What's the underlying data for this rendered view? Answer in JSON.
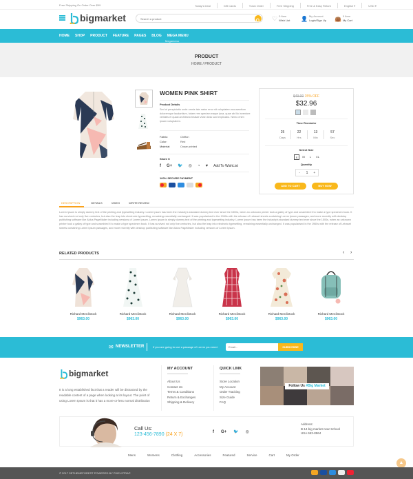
{
  "topbar": {
    "promo": "Free Shipping On Order Over $99",
    "links": [
      "Today's Deal",
      "Gift Cards",
      "Track Order",
      "Free Shipping",
      "Free & Easy Return"
    ],
    "language": "English",
    "currency": "USD"
  },
  "header": {
    "logo": "bigmarket",
    "search_placeholder": "Search a product",
    "wishlist": {
      "line1": "0 Item",
      "line2": "Wish List"
    },
    "account": {
      "line1": "My Account",
      "line2": "Login/Sign Up"
    },
    "cart": {
      "line1": "0 Item",
      "line2": "My Cart"
    }
  },
  "nav": {
    "items": [
      "HOME",
      "SHOP",
      "PRODUCT",
      "FEATURE",
      "PAGES",
      "BLOG"
    ],
    "menu_label": "MEGA MENU",
    "menu_sub": "Megamenu"
  },
  "banner": {
    "title": "PRODUCT",
    "breadcrumb_home": "HOME",
    "breadcrumb_sep": "/",
    "breadcrumb_current": "PRODUCT"
  },
  "product": {
    "title": "WOMEN PINK SHIRT",
    "details_heading": "Product Details",
    "details_text": "Sed ut perspiciatis unde omnis iste natus error sit voluptatem accusantium doloremque laudantium, totam rem aperiam eaque ipsa, quae ab illo inventore veritatis et quasi architecto beatae vitae dicta sunt explicabo. Nemo enim ipsam voluptatem.",
    "specs": [
      {
        "label": "Fabric:",
        "value": "Chiffon"
      },
      {
        "label": "Color:",
        "value": "Red"
      },
      {
        "label": "Material:",
        "value": "Crepe printed"
      }
    ],
    "share_label": "Share It",
    "wishlist_label": "Add To WishList",
    "secure_label": "100% SECURE PAYMENT"
  },
  "buybox": {
    "old_price": "$49.00",
    "discount": "15% OFF",
    "price": "$32.96",
    "time_heading": "Time Reminder",
    "countdown": [
      {
        "value": "25",
        "unit": "Days"
      },
      {
        "value": "22",
        "unit": "Hrs"
      },
      {
        "value": "13",
        "unit": "Min"
      },
      {
        "value": "57",
        "unit": "Sec"
      }
    ],
    "size_heading": "Select Size",
    "sizes": [
      "S",
      "M",
      "L",
      "XL"
    ],
    "selected_size": "S",
    "qty_heading": "Quantity",
    "qty_minus": "-",
    "qty_value": "1",
    "qty_plus": "+",
    "add_to_cart": "ADD TO CART",
    "buy_now": "BUY NOW"
  },
  "tabs": {
    "items": [
      "DESCRIPTION",
      "DETAILS",
      "VIDEO",
      "WRITE REVIEW"
    ],
    "active": "DESCRIPTION",
    "content": "Lorem Ipsum is simply dummy text of the printing and typesetting industry. Lorem Ipsum has been the industry's standard dummy text ever since the 1500s, when an unknown printer took a galley of type and scrambled it to make a type specimen book. It has survived not only five centuries, but also the leap into electronic typesetting, remaining essentially unchanged. It was popularised in the 1960s with the release of Letraset sheets containing Lorem Ipsum passages, and more recently with desktop publishing software like Aldus PageMaker including versions of Lorem Ipsum. Lorem Ipsum is simply dummy text of the printing and typesetting industry. Lorem Ipsum has been the industry's standard dummy text ever since the 1500s, when an unknown printer took a galley of type and scrambled it to make a type specimen book. It has survived not only five centuries, but also the leap into electronic typesetting, remaining essentially unchanged. It was popularised in the 1960s with the release of Letraset sheets containing Lorem Ipsum passages, and more recently with desktop publishing software like Aldus PageMaker including versions of Lorem Ipsum."
  },
  "related": {
    "heading": "RELATED PRODUCTS",
    "items": [
      {
        "name": "Richard McClintock",
        "price": "$963.00"
      },
      {
        "name": "Richard McClintock",
        "price": "$963.00"
      },
      {
        "name": "Richard McClintock",
        "price": "$963.00"
      },
      {
        "name": "Richard McClintock",
        "price": "$963.00"
      },
      {
        "name": "Richard McClintock",
        "price": "$963.00"
      },
      {
        "name": "Richard McClintock",
        "price": "$963.00"
      }
    ]
  },
  "newsletter": {
    "heading": "NEWSLETTER",
    "text": "If you are going to use a passage of Lorem you need.",
    "placeholder": "Email...",
    "button": "SUBSCRIBE"
  },
  "footer": {
    "logo": "bigmarket",
    "about": "It is a long established fact that a reader will be distracted by the readable content of a page when looking at its layout. The point of using Lorem Ipsum is that it has a more-or-less normal distribution",
    "account_heading": "MY ACCOUNT",
    "account_links": [
      "About Us",
      "Contact Us",
      "Terms & Conditions",
      "Return & Exchanges",
      "Shipping & Delivery"
    ],
    "quick_heading": "QUICK LINK",
    "quick_links": [
      "Store Location",
      "My Account",
      "Order Tracking",
      "Size Guide",
      "FAQ"
    ],
    "instagram_label": "Follow Us",
    "instagram_handle": "#Big Market",
    "call_label": "Call Us:",
    "phone": "123-456-7890",
    "hours": "(24 X 7)",
    "address_label": "Address:",
    "address_lines": [
      "B-14 big market near School",
      "USA 653-8964"
    ],
    "bottom_links": [
      "Mens",
      "Womens",
      "Clothing",
      "Accessories",
      "Featured",
      "Service",
      "Cart",
      "My Order"
    ],
    "copyright": "© 2017 SETHEMEFOREST POWERED BY PIXELSTRAP"
  },
  "colors": {
    "accent": "#2bbcd6",
    "yellow": "#f9b81b",
    "price_orange": "#f9a11b",
    "dark_footer": "#555555"
  }
}
